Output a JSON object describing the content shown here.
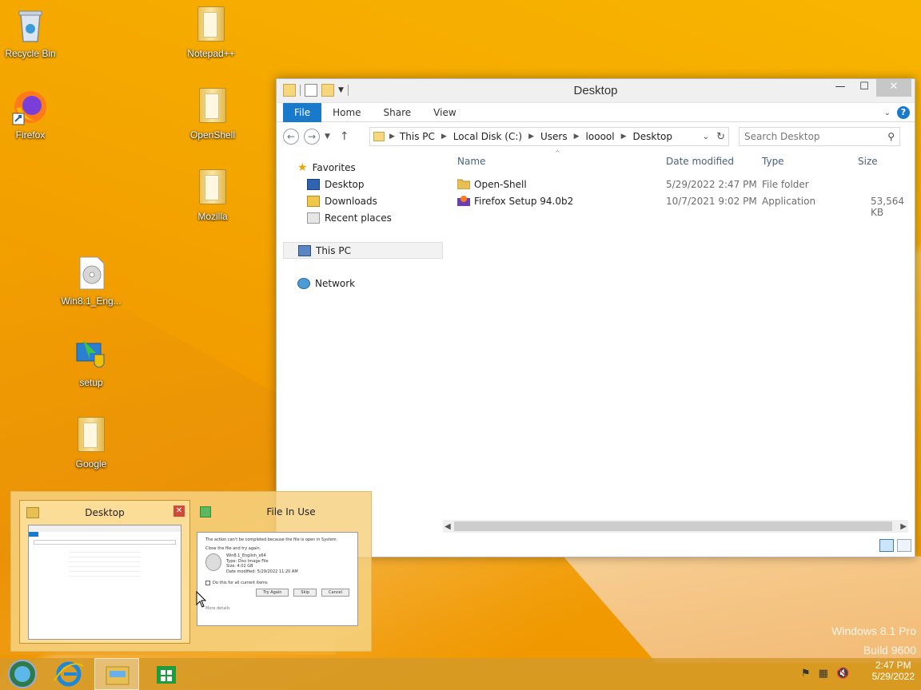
{
  "desktop": {
    "icons": [
      {
        "label": "Recycle Bin"
      },
      {
        "label": "Notepad++"
      },
      {
        "label": "Firefox"
      },
      {
        "label": "OpenShell"
      },
      {
        "label": "Mozilla"
      },
      {
        "label": "Win8.1_Eng..."
      },
      {
        "label": "setup"
      },
      {
        "label": "Google"
      }
    ],
    "watermark": {
      "line1": "Windows 8.1 Pro",
      "line2": "Build 9600"
    }
  },
  "explorer": {
    "title": "Desktop",
    "tabs": {
      "file": "File",
      "home": "Home",
      "share": "Share",
      "view": "View"
    },
    "help": "?",
    "address": {
      "crumbs": [
        "This PC",
        "Local Disk (C:)",
        "Users",
        "looool",
        "Desktop"
      ]
    },
    "search": {
      "placeholder": "Search Desktop"
    },
    "nav": {
      "favorites": "Favorites",
      "desktop": "Desktop",
      "downloads": "Downloads",
      "recent": "Recent places",
      "thispc": "This PC",
      "network": "Network"
    },
    "columns": {
      "name": "Name",
      "date": "Date modified",
      "type": "Type",
      "size": "Size"
    },
    "files": [
      {
        "name": "Open-Shell",
        "date": "5/29/2022 2:47 PM",
        "type": "File folder",
        "size": ""
      },
      {
        "name": "Firefox Setup 94.0b2",
        "date": "10/7/2021 9:02 PM",
        "type": "Application",
        "size": "53,564 KB"
      }
    ]
  },
  "thumbnails": {
    "explorer_title": "Desktop",
    "dialog_title": "File In Use",
    "dialog": {
      "message": "The action can't be completed because the file is open in System",
      "instruction": "Close the file and try again.",
      "filename": "Win8.1_English_x64",
      "filetype": "Type: Disc Image File",
      "filesize": "Size: 4.02 GB",
      "modified": "Date modified: 5/29/2022 11:20 AM",
      "checkbox": "Do this for all current items",
      "try_again": "Try Again",
      "skip": "Skip",
      "cancel": "Cancel",
      "more": "More details"
    }
  },
  "taskbar": {
    "time": "2:47 PM",
    "date": "5/29/2022"
  }
}
